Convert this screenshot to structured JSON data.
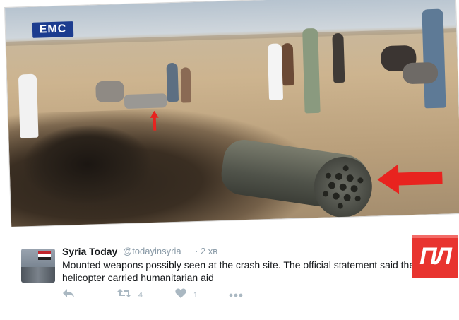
{
  "photo": {
    "logo_text": "EMC",
    "logo_subtext": ""
  },
  "tweet": {
    "display_name": "Syria Today",
    "handle": "@todayinsyria",
    "time": "· 2 хв",
    "text": "Mounted weapons possibly seen at the crash site. The official statement said the helicopter carried humanitarian aid",
    "retweet_count": "4",
    "like_count": "1"
  },
  "icons": {
    "reply": "reply-icon",
    "retweet": "retweet-icon",
    "like": "heart-icon",
    "more": "more-icon"
  },
  "badge": {
    "text": "ПЛ"
  },
  "colors": {
    "accent_red": "#e8342f",
    "text_dark": "#14171a",
    "muted": "#8899a6"
  }
}
